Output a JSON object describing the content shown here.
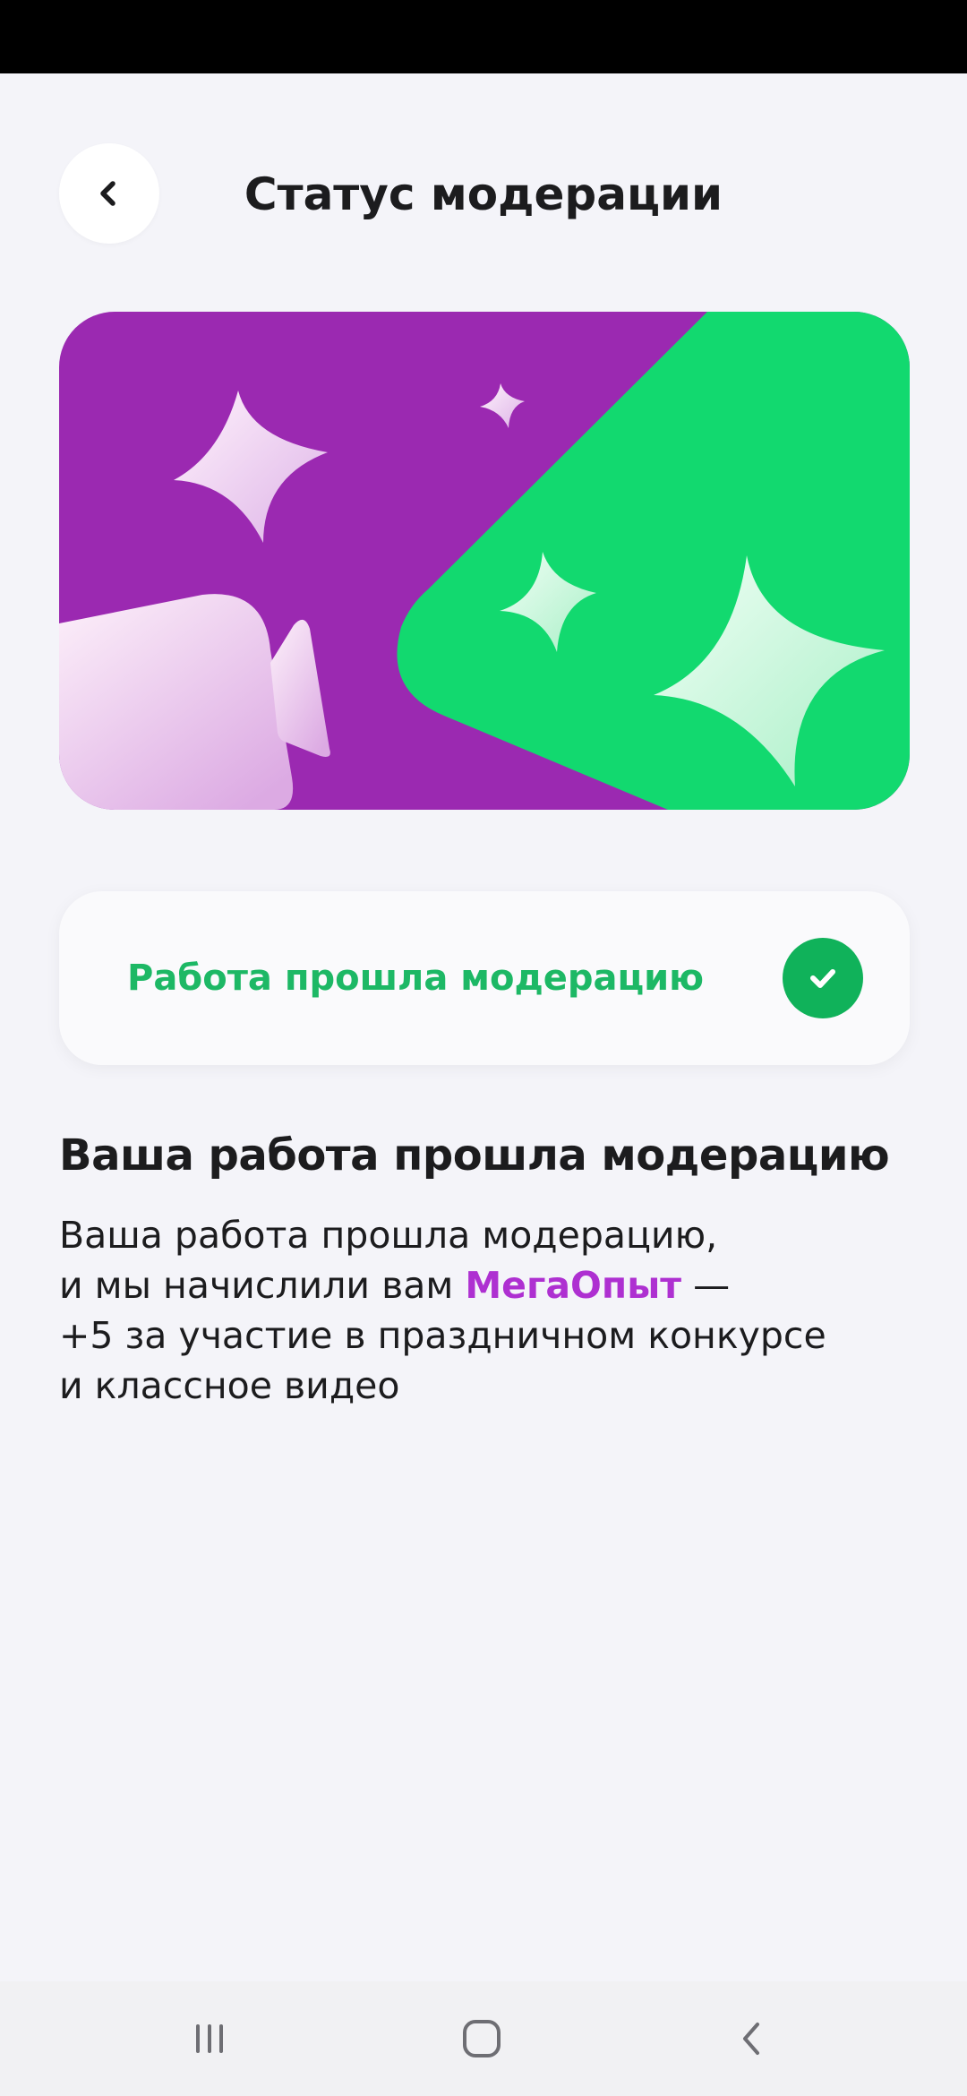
{
  "header": {
    "back_icon": "chevron-left-icon",
    "title": "Статус модерации"
  },
  "banner": {
    "colors": {
      "purple": "#9B29B1",
      "green": "#12D96F"
    }
  },
  "status_card": {
    "label": "Работа прошла модерацию",
    "icon": "check-circle-icon",
    "color": "#1DB865"
  },
  "result": {
    "title": "Ваша работа прошла модерацию",
    "line1": "Ваша работа прошла модерацию,",
    "line2_prefix": "и мы начислили вам ",
    "line2_highlight": "МегаОпыт",
    "line2_suffix": " —",
    "line3": "+5 за участие в праздничном конкурсе",
    "line4": "и классное видео",
    "highlight_color": "#AE30D1"
  },
  "nav": {
    "recents_icon": "recents-icon",
    "home_icon": "home-icon",
    "back_icon": "back-icon"
  }
}
